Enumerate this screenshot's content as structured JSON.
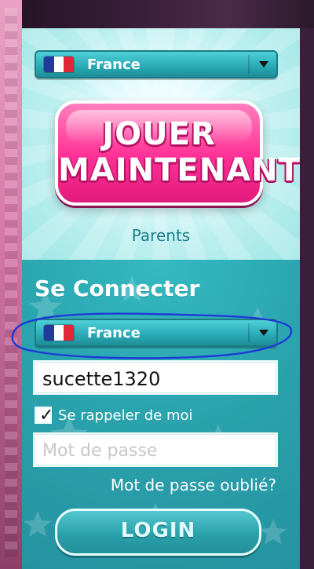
{
  "language_select_top": {
    "selected": "France"
  },
  "play_button": {
    "line1": "JOUER",
    "line2": "MAINTENANT"
  },
  "parents_link": "Parents",
  "login": {
    "title": "Se Connecter",
    "language_select": {
      "selected": "France"
    },
    "username_value": "sucette1320",
    "remember_me": {
      "label": "Se rappeler de moi",
      "checked": true
    },
    "password_placeholder": "Mot de passe",
    "forgot_password": "Mot de passe oublié?",
    "login_button": "LOGIN"
  },
  "icons": {
    "flag_icon": "flag-france-icon",
    "dropdown_icon": "chevron-down-icon",
    "check_icon": "checkmark-icon"
  },
  "colors": {
    "panel_teal": "#2a9aa4",
    "play_pink": "#ff2f95",
    "annotation_blue": "#1e3bd6"
  }
}
